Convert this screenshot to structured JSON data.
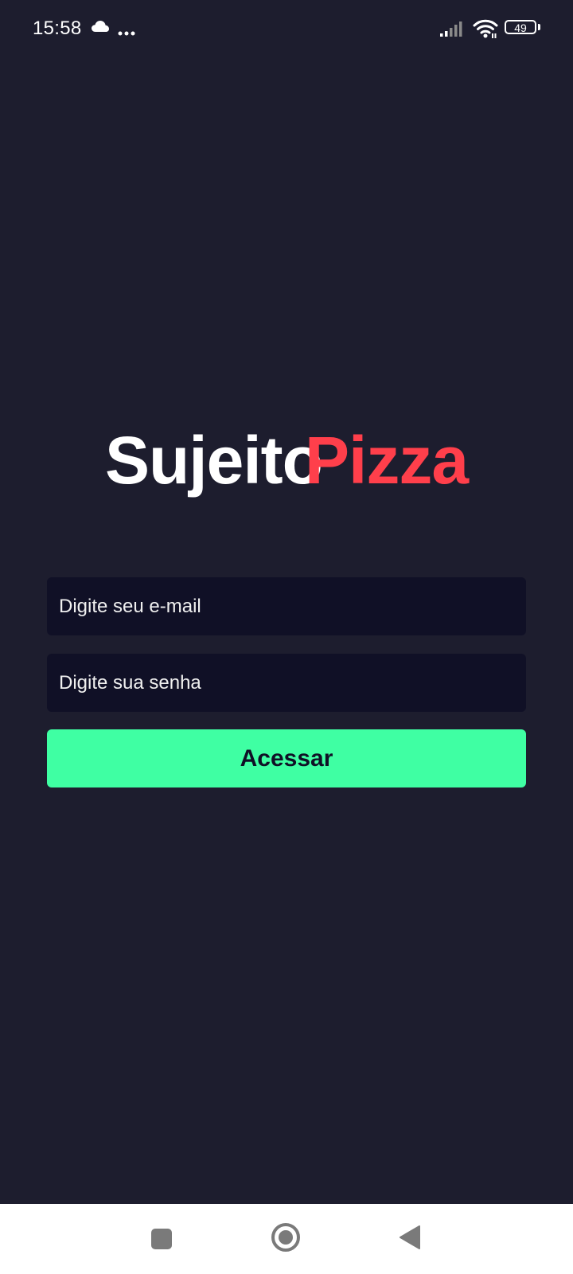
{
  "status_bar": {
    "time": "15:58",
    "battery_level": "49",
    "icons": [
      "cloud-icon",
      "more-dots-icon",
      "signal-icon",
      "wifi-icon",
      "battery-icon"
    ]
  },
  "logo": {
    "part1": "Sujeito",
    "part2": "Pizza",
    "colors": {
      "part1": "#ffffff",
      "part2": "#ff3f4b"
    }
  },
  "login_form": {
    "email_placeholder": "Digite seu e-mail",
    "email_value": "",
    "password_placeholder": "Digite sua senha",
    "password_value": "",
    "submit_label": "Acessar"
  },
  "nav_bar": {
    "icons": [
      "recents-icon",
      "home-icon",
      "back-icon"
    ]
  },
  "colors": {
    "background": "#1d1d2e",
    "input_background": "#101026",
    "button_background": "#3fffa3",
    "button_text": "#101026",
    "nav_icon": "#7a7a7a"
  }
}
